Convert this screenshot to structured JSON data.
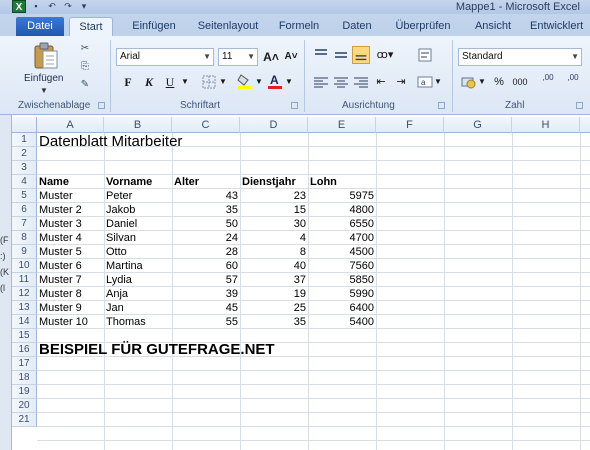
{
  "window": {
    "title": "Mappe1 - Microsoft Excel",
    "logo_letter": "X",
    "qat_icons": [
      "save-icon",
      "undo-icon",
      "redo-icon",
      "customize-icon"
    ]
  },
  "ribbon": {
    "tabs": [
      {
        "label": "Datei"
      },
      {
        "label": "Start"
      },
      {
        "label": "Einfügen"
      },
      {
        "label": "Seitenlayout"
      },
      {
        "label": "Formeln"
      },
      {
        "label": "Daten"
      },
      {
        "label": "Überprüfen"
      },
      {
        "label": "Ansicht"
      },
      {
        "label": "Entwicklert"
      }
    ],
    "groups": {
      "clipboard": "Zwischenablage",
      "font": "Schriftart",
      "alignment": "Ausrichtung",
      "number": "Zahl"
    },
    "paste_label": "Einfügen",
    "font_name": "Arial",
    "font_size": "11",
    "grow_font": "A˄",
    "shrink_font": "A˅",
    "bold": "F",
    "italic": "K",
    "underline": "U",
    "number_format": "Standard",
    "percent": "%",
    "thousands": "000",
    "dec_increase": ",00",
    "dec_decrease": ",00"
  },
  "left_strip": [
    "(F",
    ":)",
    "(K",
    "(l"
  ],
  "sheet": {
    "columns": [
      "A",
      "B",
      "C",
      "D",
      "E",
      "F",
      "G",
      "H"
    ],
    "rows": [
      "1",
      "2",
      "3",
      "4",
      "5",
      "6",
      "7",
      "8",
      "9",
      "10",
      "11",
      "12",
      "13",
      "14",
      "15",
      "16",
      "17",
      "18",
      "19",
      "20",
      "21"
    ],
    "title": "Datenblatt Mitarbeiter",
    "headers": {
      "name": "Name",
      "vorname": "Vorname",
      "alter": "Alter",
      "dienstjahr": "Dienstjahr",
      "lohn": "Lohn"
    },
    "data": [
      {
        "name": "Muster",
        "vorname": "Peter",
        "alter": "43",
        "dienst": "23",
        "lohn": "5975"
      },
      {
        "name": "Muster 2",
        "vorname": "Jakob",
        "alter": "35",
        "dienst": "15",
        "lohn": "4800"
      },
      {
        "name": "Muster 3",
        "vorname": "Daniel",
        "alter": "50",
        "dienst": "30",
        "lohn": "6550"
      },
      {
        "name": "Muster 4",
        "vorname": "Silvan",
        "alter": "24",
        "dienst": "4",
        "lohn": "4700"
      },
      {
        "name": "Muster 5",
        "vorname": "Otto",
        "alter": "28",
        "dienst": "8",
        "lohn": "4500"
      },
      {
        "name": "Muster 6",
        "vorname": "Martina",
        "alter": "60",
        "dienst": "40",
        "lohn": "7560"
      },
      {
        "name": "Muster 7",
        "vorname": "Lydia",
        "alter": "57",
        "dienst": "37",
        "lohn": "5850"
      },
      {
        "name": "Muster 8",
        "vorname": "Anja",
        "alter": "39",
        "dienst": "19",
        "lohn": "5990"
      },
      {
        "name": "Muster 9",
        "vorname": "Jan",
        "alter": "45",
        "dienst": "25",
        "lohn": "6400"
      },
      {
        "name": "Muster 10",
        "vorname": "Thomas",
        "alter": "55",
        "dienst": "35",
        "lohn": "5400"
      }
    ],
    "footer_text": "BEISPIEL FÜR GUTEFRAGE.NET"
  }
}
